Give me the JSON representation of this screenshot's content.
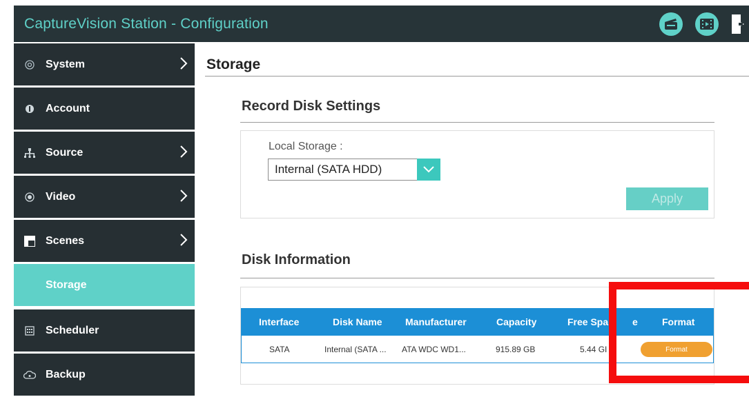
{
  "header": {
    "title": "CaptureVision Station - Configuration",
    "icons": [
      "clapperboard-icon",
      "film-icon",
      "exit-icon"
    ]
  },
  "sidebar": {
    "items": [
      {
        "label": "System",
        "icon": "gear-circle-icon",
        "has_chevron": true
      },
      {
        "label": "Account",
        "icon": "user-circle-icon",
        "has_chevron": false
      },
      {
        "label": "Source",
        "icon": "network-icon",
        "has_chevron": true
      },
      {
        "label": "Video",
        "icon": "radio-dot-icon",
        "has_chevron": true
      },
      {
        "label": "Scenes",
        "icon": "scene-icon",
        "has_chevron": true
      },
      {
        "label": "Storage",
        "icon": "",
        "has_chevron": false,
        "active": true
      },
      {
        "label": "Scheduler",
        "icon": "calendar-icon",
        "has_chevron": false
      },
      {
        "label": "Backup",
        "icon": "cloud-icon",
        "has_chevron": false
      }
    ]
  },
  "main": {
    "page_title": "Storage",
    "record_disk": {
      "title": "Record Disk Settings",
      "local_storage_label": "Local Storage :",
      "selected_value": "Internal (SATA HDD)",
      "apply_label": "Apply"
    },
    "disk_info": {
      "title": "Disk Information",
      "columns": [
        "Interface",
        "Disk Name",
        "Manufacturer",
        "Capacity",
        "Free Spa",
        "e",
        "Format"
      ],
      "row": {
        "interface": "SATA",
        "disk_name": "Internal (SATA ...",
        "manufacturer": "ATA WDC WD1...",
        "capacity": "915.89 GB",
        "free_space": "5.44 GI",
        "format_label": "Format"
      }
    }
  },
  "colors": {
    "accent": "#5fd1c8",
    "header_bg": "#273438",
    "sidebar_bg": "#262f33",
    "table_header": "#1c8fd6",
    "format_button": "#f0a030",
    "highlight": "#f50d0d"
  }
}
